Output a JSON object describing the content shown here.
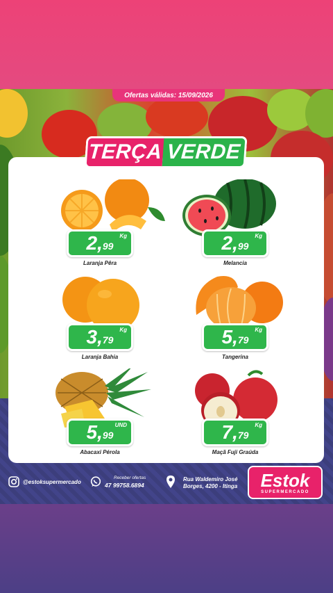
{
  "flyer": {
    "validity": "Ofertas válidas: 15/09/2026",
    "title_left": "TERÇA",
    "title_right": "VERDE"
  },
  "products": [
    {
      "name": "Laranja Pêra",
      "price_int": "2",
      "price_cents": "99",
      "unit": "Kg",
      "icon": "orange-icon"
    },
    {
      "name": "Melancia",
      "price_int": "2",
      "price_cents": "99",
      "unit": "Kg",
      "icon": "watermelon-icon"
    },
    {
      "name": "Laranja Bahia",
      "price_int": "3",
      "price_cents": "79",
      "unit": "Kg",
      "icon": "orange-icon"
    },
    {
      "name": "Tangerina",
      "price_int": "5",
      "price_cents": "79",
      "unit": "Kg",
      "icon": "tangerine-icon"
    },
    {
      "name": "Abacaxi Pérola",
      "price_int": "5",
      "price_cents": "99",
      "unit": "UND",
      "icon": "pineapple-icon"
    },
    {
      "name": "Maçã Fuji Graúda",
      "price_int": "7",
      "price_cents": "79",
      "unit": "Kg",
      "icon": "apple-icon"
    }
  ],
  "footer": {
    "instagram": "@estoksupermercado",
    "whatsapp_label": "Receber ofertas",
    "whatsapp_number": "47 99758.6894",
    "address_line1": "Rua Waldemiro José",
    "address_line2": "Borges, 4200 - Itinga"
  },
  "brand": {
    "name": "Estok",
    "sub": "SUPERMERCADO"
  },
  "colors": {
    "pink": "#e8226a",
    "green": "#2fb64b",
    "navy": "#3c3e7c"
  }
}
